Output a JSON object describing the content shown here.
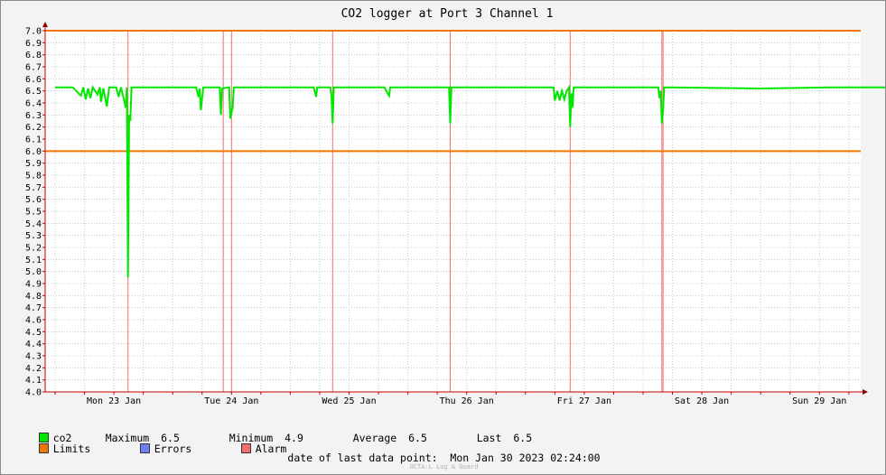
{
  "chart_data": {
    "type": "line",
    "title": "CO2 logger at Port 3 Channel 1",
    "x_tick_labels": [
      "Mon 23 Jan",
      "Tue 24 Jan",
      "Wed 25 Jan",
      "Thu 26 Jan",
      "Fri 27 Jan",
      "Sat 28 Jan",
      "Sun 29 Jan"
    ],
    "x_range_days": [
      0,
      7.26
    ],
    "ylim": [
      4.0,
      7.0
    ],
    "y_tick_step": 0.1,
    "grid": true,
    "series": [
      {
        "name": "co2",
        "color": "#00e800",
        "points": [
          [
            0.0,
            6.53
          ],
          [
            0.15,
            6.53
          ],
          [
            0.22,
            6.46
          ],
          [
            0.24,
            6.53
          ],
          [
            0.26,
            6.43
          ],
          [
            0.28,
            6.52
          ],
          [
            0.3,
            6.44
          ],
          [
            0.32,
            6.53
          ],
          [
            0.36,
            6.47
          ],
          [
            0.38,
            6.53
          ],
          [
            0.39,
            6.41
          ],
          [
            0.41,
            6.52
          ],
          [
            0.44,
            6.37
          ],
          [
            0.46,
            6.53
          ],
          [
            0.52,
            6.53
          ],
          [
            0.54,
            6.45
          ],
          [
            0.56,
            6.53
          ],
          [
            0.59,
            6.41
          ],
          [
            0.6,
            6.36
          ],
          [
            0.61,
            6.53
          ],
          [
            0.62,
            4.95
          ],
          [
            0.63,
            6.3
          ],
          [
            0.64,
            6.25
          ],
          [
            0.65,
            6.53
          ],
          [
            1.0,
            6.53
          ],
          [
            1.2,
            6.53
          ],
          [
            1.22,
            6.45
          ],
          [
            1.23,
            6.52
          ],
          [
            1.24,
            6.34
          ],
          [
            1.26,
            6.53
          ],
          [
            1.4,
            6.53
          ],
          [
            1.41,
            6.3
          ],
          [
            1.42,
            6.52
          ],
          [
            1.48,
            6.53
          ],
          [
            1.49,
            6.27
          ],
          [
            1.51,
            6.36
          ],
          [
            1.52,
            6.53
          ],
          [
            2.0,
            6.53
          ],
          [
            2.2,
            6.53
          ],
          [
            2.22,
            6.45
          ],
          [
            2.23,
            6.53
          ],
          [
            2.34,
            6.53
          ],
          [
            2.35,
            6.46
          ],
          [
            2.36,
            6.23
          ],
          [
            2.37,
            6.53
          ],
          [
            2.8,
            6.53
          ],
          [
            2.84,
            6.46
          ],
          [
            2.85,
            6.53
          ],
          [
            3.35,
            6.53
          ],
          [
            3.36,
            6.23
          ],
          [
            3.37,
            6.53
          ],
          [
            4.0,
            6.53
          ],
          [
            4.24,
            6.53
          ],
          [
            4.25,
            6.42
          ],
          [
            4.27,
            6.5
          ],
          [
            4.29,
            6.42
          ],
          [
            4.31,
            6.5
          ],
          [
            4.33,
            6.43
          ],
          [
            4.35,
            6.5
          ],
          [
            4.37,
            6.53
          ],
          [
            4.38,
            6.2
          ],
          [
            4.39,
            6.48
          ],
          [
            4.4,
            6.36
          ],
          [
            4.41,
            6.53
          ],
          [
            5.0,
            6.53
          ],
          [
            5.13,
            6.53
          ],
          [
            5.14,
            6.44
          ],
          [
            5.15,
            6.5
          ],
          [
            5.16,
            6.23
          ],
          [
            5.17,
            6.34
          ],
          [
            5.18,
            6.53
          ],
          [
            6.0,
            6.52
          ],
          [
            6.6,
            6.53
          ],
          [
            7.0,
            6.53
          ],
          [
            7.26,
            6.53
          ]
        ]
      },
      {
        "name": "Limits",
        "color": "#f07800",
        "values": [
          7.0,
          6.0
        ]
      },
      {
        "name": "Errors",
        "color": "#6f7ff0"
      },
      {
        "name": "Alarm",
        "color": "#f07070",
        "alarm_days": [
          0.62,
          1.43,
          1.5,
          2.36,
          3.36,
          4.38,
          5.16,
          5.17
        ]
      }
    ]
  },
  "legend": {
    "co2": {
      "label": "co2",
      "max_label": "Maximum",
      "max_value": "6.5",
      "min_label": "Minimum",
      "min_value": "4.9",
      "avg_label": "Average",
      "avg_value": "6.5",
      "last_label": "Last",
      "last_value": "6.5"
    },
    "limits_label": "Limits",
    "errors_label": "Errors",
    "alarm_label": "Alarm"
  },
  "footer": {
    "last_point_label": "date of last data point:",
    "last_point_value": "Mon Jan 30 2023 02:24:00",
    "credit": "OCTA-L Log & Guard"
  }
}
